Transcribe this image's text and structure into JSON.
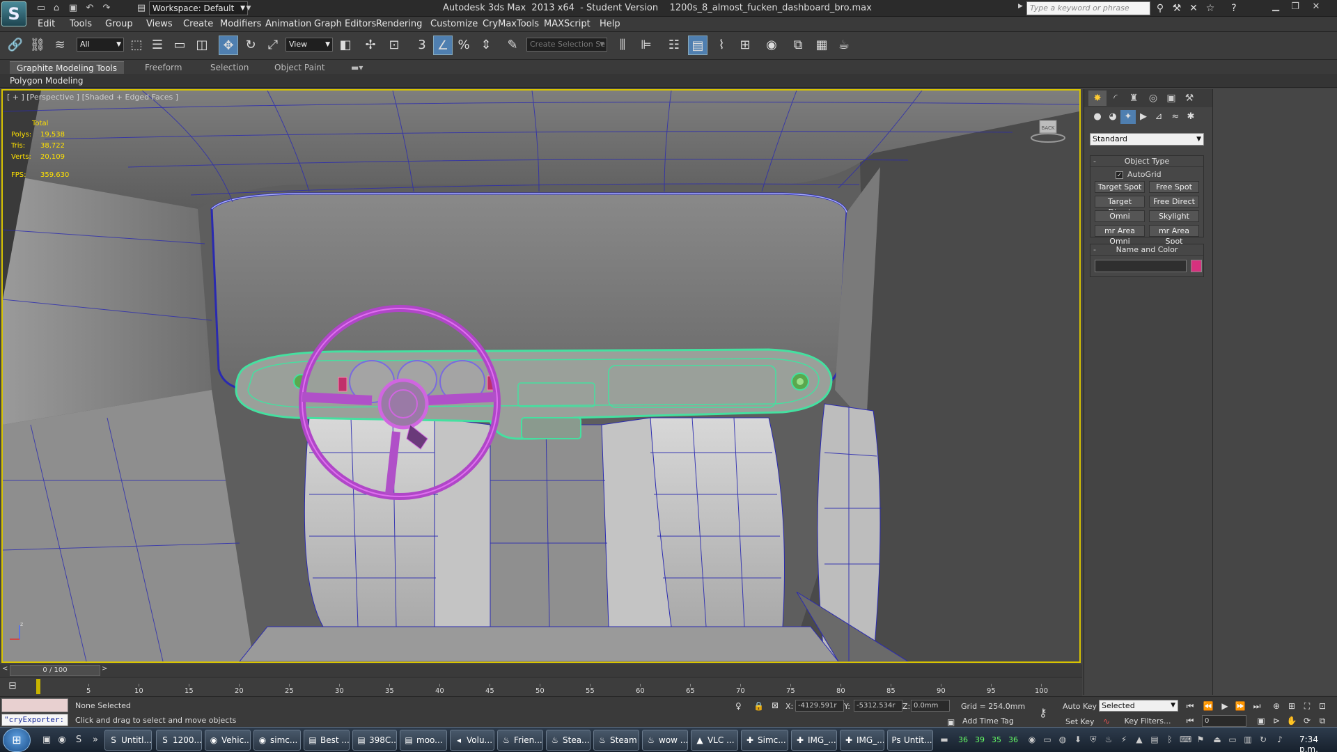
{
  "titlebar": {
    "workspace": "Workspace: Default",
    "title": "Autodesk 3ds Max  2013 x64  - Student Version    1200s_8_almost_fucken_dashboard_bro.max",
    "search_placeholder": "Type a keyword or phrase"
  },
  "menu": [
    "Edit",
    "Tools",
    "Group",
    "Views",
    "Create",
    "Modifiers",
    "Animation",
    "Graph Editors",
    "Rendering",
    "Customize",
    "CryMaxTools",
    "MAXScript",
    "Help"
  ],
  "toolbar": {
    "selection_filter": "All",
    "ref_coord": "View",
    "named_selection": "Create Selection Se"
  },
  "ribbon": {
    "tabs": [
      "Graphite Modeling Tools",
      "Freeform",
      "Selection",
      "Object Paint"
    ],
    "panel_label": "Polygon Modeling"
  },
  "viewport": {
    "label": "[ + ] [Perspective ] [Shaded + Edged Faces ]",
    "stats": {
      "header": "Total",
      "polys_label": "Polys:",
      "polys": "19,538",
      "tris_label": "Tris:",
      "tris": "38,722",
      "verts_label": "Verts:",
      "verts": "20,109",
      "fps_label": "FPS:",
      "fps": "359.630"
    },
    "viewcube_label": "BACK",
    "axis_label": "z"
  },
  "command_panel": {
    "category": "Standard",
    "object_type_title": "Object Type",
    "autogrid": "AutoGrid",
    "buttons": [
      "Target Spot",
      "Free Spot",
      "Target Direct",
      "Free Direct",
      "Omni",
      "Skylight",
      "mr Area Omni",
      "mr Area Spot"
    ],
    "name_color_title": "Name and Color",
    "swatch_color": "#d6317e"
  },
  "timeline": {
    "frame": "0 / 100",
    "ticks": [
      "5",
      "10",
      "15",
      "20",
      "25",
      "30",
      "35",
      "40",
      "45",
      "50",
      "55",
      "60",
      "65",
      "70",
      "75",
      "80",
      "85",
      "90",
      "95",
      "100"
    ]
  },
  "status": {
    "maxscript": "\"cryExporter:",
    "selection": "None Selected",
    "prompt": "Click and drag to select and move objects",
    "x_label": "X:",
    "x": "-4129.591r",
    "y_label": "Y:",
    "y": "-5312.534r",
    "z_label": "Z:",
    "z": "0.0mm",
    "grid": "Grid = 254.0mm",
    "add_time_tag": "Add Time Tag",
    "auto_key": "Auto Key",
    "set_key": "Set Key",
    "selected": "Selected",
    "key_filters": "Key Filters...",
    "current_frame": "0"
  },
  "taskbar": {
    "items": [
      "Untitl...",
      "1200...",
      "Vehic...",
      "simc...",
      "Best ...",
      "398C...",
      "moo...",
      "Volu...",
      "Frien...",
      "Stea...",
      "Steam",
      "wow ...",
      "VLC ...",
      "Simc...",
      "IMG_...",
      "IMG_...",
      "Untit..."
    ],
    "tray_numbers": [
      "36",
      "39",
      "35",
      "36"
    ],
    "clock": "7:34 p.m."
  }
}
